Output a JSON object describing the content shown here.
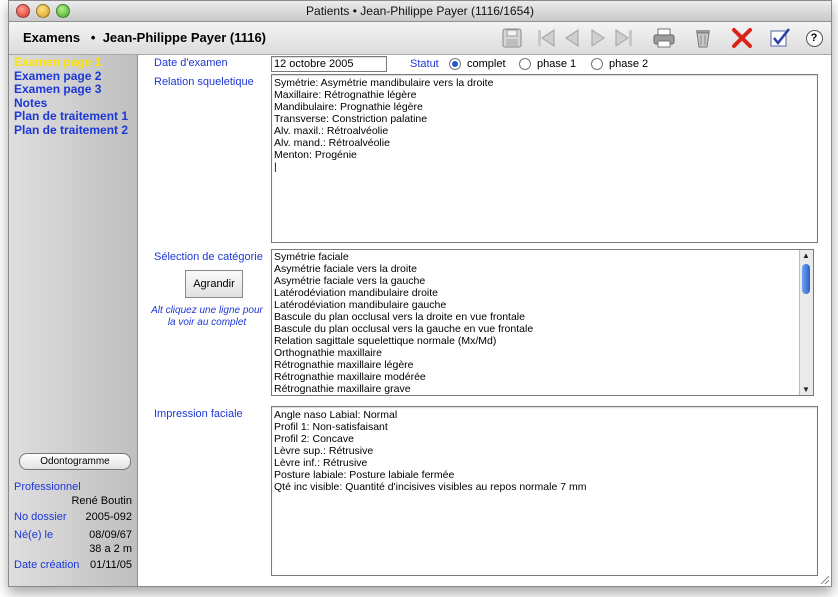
{
  "window": {
    "title": "Patients • Jean-Philippe Payer (1116/1654)"
  },
  "toolbar": {
    "header": "Examens   •  Jean-Philippe Payer (1116)",
    "icons": [
      "save-icon",
      "first-record-icon",
      "previous-record-icon",
      "next-record-icon",
      "last-record-icon",
      "print-icon",
      "trash-icon",
      "cancel-icon",
      "validate-icon",
      "help-icon"
    ],
    "help_label": "?"
  },
  "sidebar": {
    "items": [
      {
        "label": "Examen page 1",
        "active": true
      },
      {
        "label": "Examen page 2"
      },
      {
        "label": "Examen page 3"
      },
      {
        "label": "Notes"
      },
      {
        "label": "Plan de traitement 1"
      },
      {
        "label": "Plan de traitement 2"
      }
    ],
    "odontogramme_label": "Odontogramme",
    "professionnel_label": "Professionnel",
    "professionnel_value": "René Boutin",
    "dossier_label": "No dossier",
    "dossier_value": "2005-092",
    "ne_label": "Né(e) le",
    "ne_value": "08/09/67",
    "age_value": "38 a 2 m",
    "creation_label": "Date création",
    "creation_value": "01/11/05"
  },
  "form": {
    "date_label": "Date d'examen",
    "date_value": "12 octobre 2005",
    "statut_label": "Statut",
    "statut_options": [
      "complet",
      "phase 1",
      "phase 2"
    ],
    "statut_selected": "complet",
    "relation_label": "Relation squeletique",
    "relation_text": "Symétrie: Asymétrie mandibulaire vers la droite\nMaxillaire: Rétrognathie légère\nMandibulaire: Prognathie légère\nTransverse: Constriction palatine\nAlv. maxil.: Rétroalvéolie\nAlv. mand.: Rétroalvéolie\nMenton: Progénie\n|",
    "categorie_label": "Sélection de catégorie",
    "agrandir_label": "Agrandir",
    "hint": "Alt cliquez une ligne pour la voir au complet",
    "categories": [
      "Symétrie faciale",
      "Asymétrie faciale vers la droite",
      "Asymétrie faciale vers la gauche",
      "Latérodéviation mandibulaire droite",
      "Latérodéviation mandibulaire gauche",
      "Bascule du plan occlusal vers la droite en vue frontale",
      "Bascule du plan occlusal vers la gauche en vue frontale",
      "Relation sagittale squelettique normale (Mx/Md)",
      "Orthognathie maxillaire",
      "Rétrognathie maxillaire légère",
      "Rétrognathie maxillaire modérée",
      "Rétrognathie maxillaire grave"
    ],
    "impression_label": "Impression faciale",
    "impression_text": "Angle naso Labial: Normal\nProfil 1: Non-satisfaisant\nProfil 2: Concave\nLèvre sup.: Rétrusive\nLèvre inf.: Rétrusive\nPosture labiale: Posture labiale fermée\nQté inc visible: Quantité d'incisives visibles au repos normale 7 mm"
  },
  "colors": {
    "link": "#1d37d6",
    "active": "#ffe400",
    "cancel": "#d9231b"
  }
}
